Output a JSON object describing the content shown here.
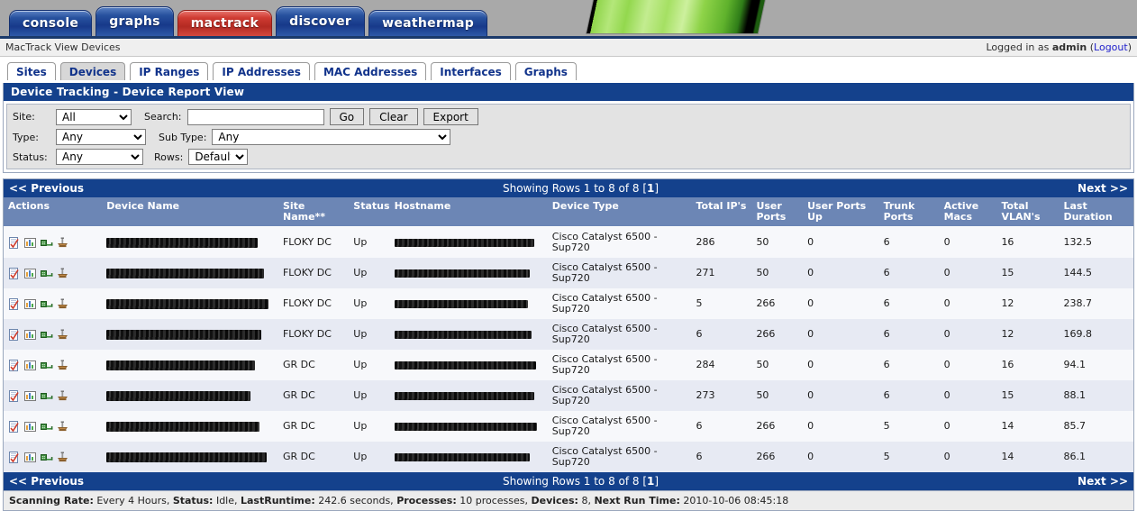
{
  "nav": {
    "tabs": [
      {
        "label": "console",
        "active": false,
        "color": "blue"
      },
      {
        "label": "graphs",
        "active": false,
        "color": "blue"
      },
      {
        "label": "mactrack",
        "active": true,
        "color": "red"
      },
      {
        "label": "discover",
        "active": false,
        "color": "blue"
      },
      {
        "label": "weathermap",
        "active": false,
        "color": "blue"
      }
    ]
  },
  "breadcrumb": {
    "path": "MacTrack View Devices",
    "logged_in_prefix": "Logged in as ",
    "user": "admin",
    "paren_open": " (",
    "logout": "Logout",
    "paren_close": ")"
  },
  "subtabs": [
    {
      "label": "Sites",
      "active": false
    },
    {
      "label": "Devices",
      "active": true
    },
    {
      "label": "IP Ranges",
      "active": false
    },
    {
      "label": "IP Addresses",
      "active": false
    },
    {
      "label": "MAC Addresses",
      "active": false
    },
    {
      "label": "Interfaces",
      "active": false
    },
    {
      "label": "Graphs",
      "active": false
    }
  ],
  "panel": {
    "title": "Device Tracking - Device Report View"
  },
  "filters": {
    "site_label": "Site:",
    "site_value": "All",
    "site_options": [
      "All"
    ],
    "search_label": "Search:",
    "search_value": "",
    "search_placeholder": "",
    "go_label": "Go",
    "clear_label": "Clear",
    "export_label": "Export",
    "type_label": "Type:",
    "type_value": "Any",
    "type_options": [
      "Any"
    ],
    "subtype_label": "Sub Type:",
    "subtype_value": "Any",
    "subtype_options": [
      "Any"
    ],
    "status_label": "Status:",
    "status_value": "Any",
    "status_options": [
      "Any"
    ],
    "rows_label": "Rows:",
    "rows_value": "Default",
    "rows_options": [
      "Default"
    ]
  },
  "pagination": {
    "previous": "<< Previous",
    "showing_prefix": "Showing Rows 1 to 8 of 8 [",
    "page": "1",
    "showing_suffix": "]",
    "next": "Next >>"
  },
  "table": {
    "columns": [
      "Actions",
      "Device Name",
      "Site Name**",
      "Status",
      "Hostname",
      "Device Type",
      "Total IP's",
      "User Ports",
      "User Ports Up",
      "Trunk Ports",
      "Active Macs",
      "Total VLAN's",
      "Last Duration"
    ],
    "action_icons": [
      "edit-device-icon",
      "view-graphs-icon",
      "view-ports-icon",
      "run-discovery-icon"
    ],
    "rows": [
      {
        "device_name": "",
        "device_name_redacted": true,
        "device_name_w": 168,
        "site": "FLOKY DC",
        "status": "Up",
        "hostname": "",
        "hostname_redacted": true,
        "hostname_w": 155,
        "device_type": "Cisco Catalyst 6500 - Sup720",
        "total_ips": "286",
        "user_ports": "50",
        "user_ports_up": "0",
        "trunk_ports": "6",
        "active_macs": "0",
        "total_vlans": "16",
        "last_duration": "132.5"
      },
      {
        "device_name": "",
        "device_name_redacted": true,
        "device_name_w": 175,
        "site": "FLOKY DC",
        "status": "Up",
        "hostname": "",
        "hostname_redacted": true,
        "hostname_w": 150,
        "device_type": "Cisco Catalyst 6500 - Sup720",
        "total_ips": "271",
        "user_ports": "50",
        "user_ports_up": "0",
        "trunk_ports": "6",
        "active_macs": "0",
        "total_vlans": "15",
        "last_duration": "144.5"
      },
      {
        "device_name": "",
        "device_name_redacted": true,
        "device_name_w": 180,
        "site": "FLOKY DC",
        "status": "Up",
        "hostname": "",
        "hostname_redacted": true,
        "hostname_w": 148,
        "device_type": "Cisco Catalyst 6500 - Sup720",
        "total_ips": "5",
        "user_ports": "266",
        "user_ports_up": "0",
        "trunk_ports": "6",
        "active_macs": "0",
        "total_vlans": "12",
        "last_duration": "238.7"
      },
      {
        "device_name": "",
        "device_name_redacted": true,
        "device_name_w": 172,
        "site": "FLOKY DC",
        "status": "Up",
        "hostname": "",
        "hostname_redacted": true,
        "hostname_w": 152,
        "device_type": "Cisco Catalyst 6500 - Sup720",
        "total_ips": "6",
        "user_ports": "266",
        "user_ports_up": "0",
        "trunk_ports": "6",
        "active_macs": "0",
        "total_vlans": "12",
        "last_duration": "169.8"
      },
      {
        "device_name": "",
        "device_name_redacted": true,
        "device_name_w": 165,
        "site": "GR DC",
        "status": "Up",
        "hostname": "",
        "hostname_redacted": true,
        "hostname_w": 157,
        "device_type": "Cisco Catalyst 6500 - Sup720",
        "total_ips": "284",
        "user_ports": "50",
        "user_ports_up": "0",
        "trunk_ports": "6",
        "active_macs": "0",
        "total_vlans": "16",
        "last_duration": "94.1"
      },
      {
        "device_name": "",
        "device_name_redacted": true,
        "device_name_w": 160,
        "site": "GR DC",
        "status": "Up",
        "hostname": "",
        "hostname_redacted": true,
        "hostname_w": 155,
        "device_type": "Cisco Catalyst 6500 - Sup720",
        "total_ips": "273",
        "user_ports": "50",
        "user_ports_up": "0",
        "trunk_ports": "6",
        "active_macs": "0",
        "total_vlans": "15",
        "last_duration": "88.1"
      },
      {
        "device_name": "",
        "device_name_redacted": true,
        "device_name_w": 170,
        "site": "GR DC",
        "status": "Up",
        "hostname": "",
        "hostname_redacted": true,
        "hostname_w": 158,
        "device_type": "Cisco Catalyst 6500 - Sup720",
        "total_ips": "6",
        "user_ports": "266",
        "user_ports_up": "0",
        "trunk_ports": "5",
        "active_macs": "0",
        "total_vlans": "14",
        "last_duration": "85.7"
      },
      {
        "device_name": "",
        "device_name_redacted": true,
        "device_name_w": 178,
        "site": "GR DC",
        "status": "Up",
        "hostname": "",
        "hostname_redacted": true,
        "hostname_w": 150,
        "device_type": "Cisco Catalyst 6500 - Sup720",
        "total_ips": "6",
        "user_ports": "266",
        "user_ports_up": "0",
        "trunk_ports": "5",
        "active_macs": "0",
        "total_vlans": "14",
        "last_duration": "86.1"
      }
    ]
  },
  "status": {
    "scanning_rate_label": "Scanning Rate:",
    "scanning_rate_value": " Every 4 Hours, ",
    "status_label": "Status:",
    "status_value": " Idle, ",
    "lastruntime_label": "LastRuntime:",
    "lastruntime_value": " 242.6 seconds, ",
    "processes_label": "Processes:",
    "processes_value": " 10 processes, ",
    "devices_label": "Devices:",
    "devices_value": " 8, ",
    "nextrun_label": "Next Run Time:",
    "nextrun_value": " 2010-10-06 08:45:18"
  },
  "colors": {
    "header_blue": "#14418c",
    "table_header": "#6c86b5",
    "tab_blue": "#27519e",
    "tab_red": "#cf3b32",
    "status_up": "#3f7b3f",
    "link": "#2222cc"
  }
}
